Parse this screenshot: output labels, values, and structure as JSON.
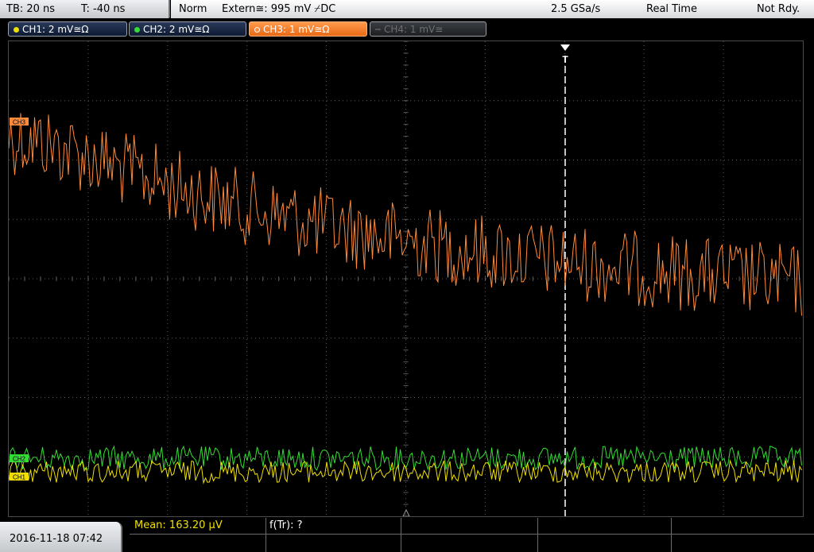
{
  "header": {
    "timebase": "TB: 20 ns",
    "trigger_time": "T: -40 ns",
    "acq_mode": "Norm",
    "trigger_source": "Extern≅: 995 mV ⌿DC",
    "sample_rate": "2.5 GSa/s",
    "mode": "Real Time",
    "status": "Not Rdy."
  },
  "channels": [
    {
      "label": "CH1: 2 mV≅Ω",
      "color": "#f0e000",
      "state": "on"
    },
    {
      "label": "CH2: 2 mV≅Ω",
      "color": "#33dd33",
      "state": "on"
    },
    {
      "label": "CH3: 1 mV≅Ω",
      "color": "#ff8a3a",
      "state": "active"
    },
    {
      "label": "CH4: 1 mV≅",
      "color": "#6b6f74",
      "state": "off"
    }
  ],
  "markers": {
    "trigger": "T",
    "ch3": "CH3",
    "ch2": "CH2",
    "ch1": "CH1"
  },
  "footer": {
    "datetime": "2016-11-18 07:42",
    "mean": "Mean: 163.20 µV",
    "ftr": "f(Tr): ?"
  },
  "colors": {
    "ch1": "#f0e000",
    "ch2": "#33dd33",
    "ch3": "#ff8a3a",
    "grid": "#5a5a5a"
  }
}
